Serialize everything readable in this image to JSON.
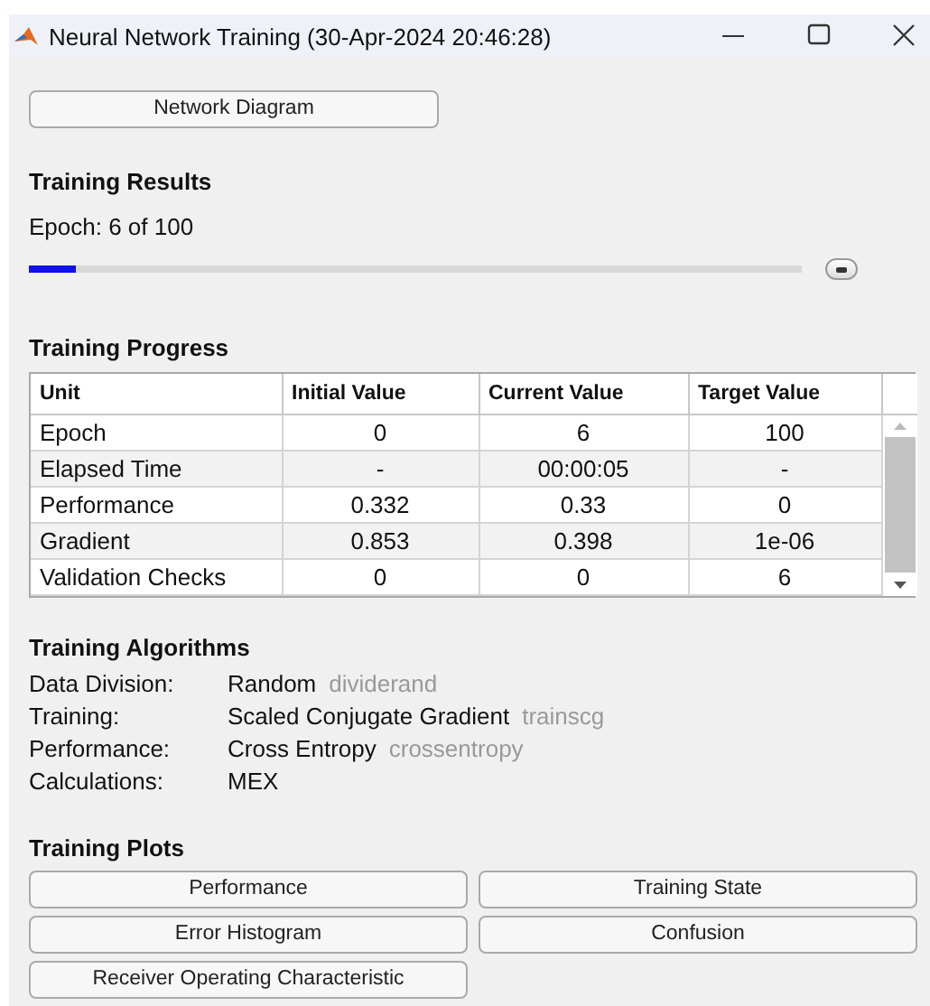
{
  "window": {
    "title": "Neural Network Training (30-Apr-2024 20:46:28)"
  },
  "network_button": "Network Diagram",
  "training_results": {
    "heading": "Training Results",
    "epoch_text": "Epoch: 6 of 100",
    "progress": {
      "level": 0.06
    }
  },
  "training_progress": {
    "heading": "Training Progress",
    "columns": [
      "Unit",
      "Initial Value",
      "Current Value",
      "Target Value"
    ],
    "rows": [
      [
        "Epoch",
        "0",
        "6",
        "100"
      ],
      [
        "Elapsed Time",
        "-",
        "00:00:05",
        "-"
      ],
      [
        "Performance",
        "0.332",
        "0.33",
        "0"
      ],
      [
        "Gradient",
        "0.853",
        "0.398",
        "1e-06"
      ],
      [
        "Validation Checks",
        "0",
        "0",
        "6"
      ]
    ]
  },
  "training_algorithms": {
    "heading": "Training Algorithms",
    "items": [
      {
        "label": "Data Division:",
        "value": "Random",
        "function": "dividerand"
      },
      {
        "label": "Training:",
        "value": "Scaled Conjugate Gradient",
        "function": "trainscg"
      },
      {
        "label": "Performance:",
        "value": "Cross Entropy",
        "function": "crossentropy"
      },
      {
        "label": "Calculations:",
        "value": "MEX"
      }
    ]
  },
  "training_plots": {
    "heading": "Training Plots",
    "buttons": [
      "Performance",
      "Training State",
      "Error Histogram",
      "Confusion",
      "Receiver Operating Characteristic"
    ]
  }
}
